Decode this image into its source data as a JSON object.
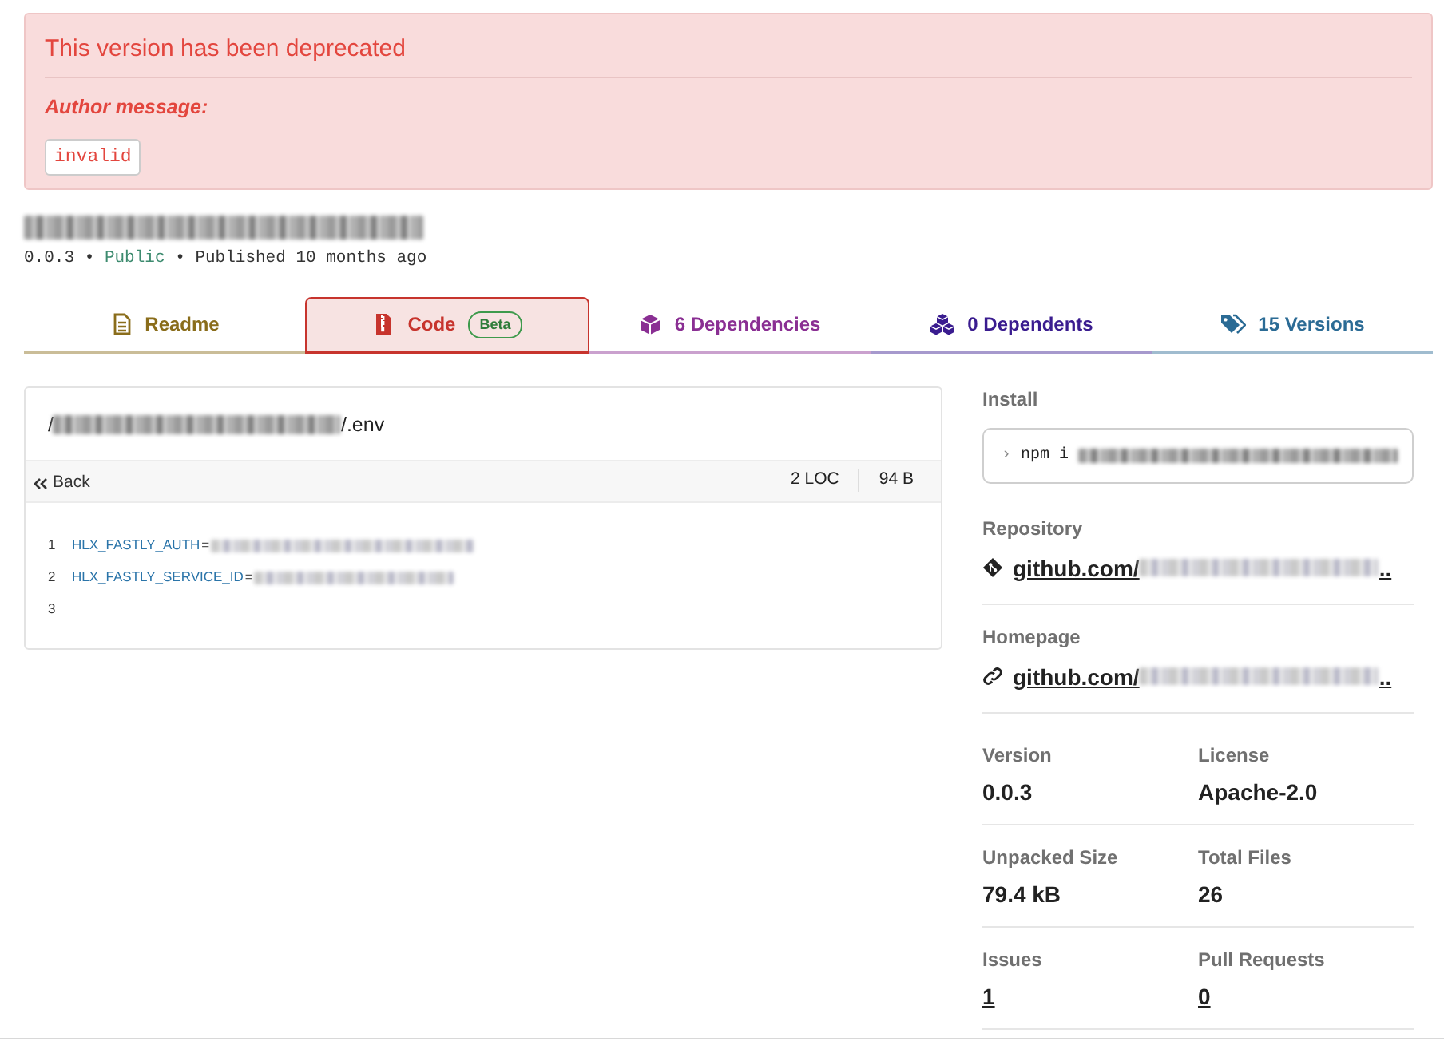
{
  "alert": {
    "title": "This version has been deprecated",
    "label": "Author message:",
    "message": "invalid"
  },
  "package": {
    "name_blurred": true,
    "meta": [
      {
        "text": "0.0.3",
        "kind": "plain"
      },
      {
        "text": "•",
        "kind": "separator"
      },
      {
        "text": "Public",
        "kind": "visibility"
      },
      {
        "text": "•",
        "kind": "separator"
      },
      {
        "text": "Published 10 months ago",
        "kind": "plain"
      }
    ]
  },
  "tabs": [
    {
      "label": "Readme",
      "selected": false,
      "color": "#8a6d1b"
    },
    {
      "label": "Code",
      "selected": true,
      "color": "#c7342d",
      "badge": "Beta"
    },
    {
      "label": "6 Dependencies",
      "selected": false,
      "color": "#8a2f93"
    },
    {
      "label": "0 Dependents",
      "selected": false,
      "color": "#3a1c8f"
    },
    {
      "label": "15 Versions",
      "selected": false,
      "color": "#2b6b95"
    }
  ],
  "code_view": {
    "path_prefix": "/",
    "path_blurred": true,
    "path_suffix": "/.env",
    "back": "Back",
    "loc": "2 LOC",
    "size": "94 B",
    "lines": [
      {
        "number": "1",
        "key": "HLX_FASTLY_AUTH",
        "operator": "=",
        "value_blurred": true
      },
      {
        "number": "2",
        "key": "HLX_FASTLY_SERVICE_ID",
        "operator": "=",
        "value_blurred": true
      },
      {
        "number": "3"
      }
    ]
  },
  "sidebar": {
    "install": {
      "label": "Install",
      "prompt": "›",
      "command": "npm i",
      "package_blurred": true
    },
    "repository": {
      "label": "Repository",
      "link": "github.com/",
      "link_blurred": true,
      "ellipsis": ".."
    },
    "homepage": {
      "label": "Homepage",
      "link": "github.com/",
      "link_blurred": true,
      "ellipsis": ".."
    },
    "stats": [
      {
        "label": "Version",
        "value": "0.0.3",
        "kind": "text"
      },
      {
        "label": "License",
        "value": "Apache-2.0",
        "kind": "text"
      },
      {
        "label": "Unpacked Size",
        "value": "79.4 kB",
        "kind": "text"
      },
      {
        "label": "Total Files",
        "value": "26",
        "kind": "text"
      },
      {
        "label": "Issues",
        "value": "1",
        "kind": "link"
      },
      {
        "label": "Pull Requests",
        "value": "0",
        "kind": "link"
      }
    ]
  }
}
